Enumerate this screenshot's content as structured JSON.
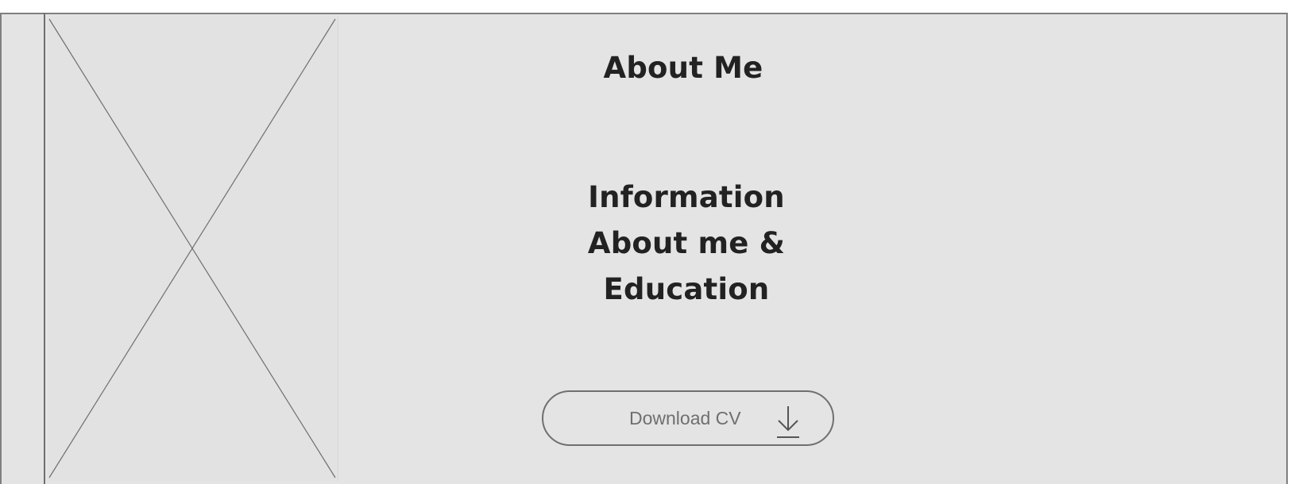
{
  "about": {
    "title": "About Me",
    "info_lines": [
      "Information",
      "About me &",
      "Education"
    ]
  },
  "image": {
    "placeholder_icon": "image-placeholder-x"
  },
  "actions": {
    "download_label": "Download CV",
    "download_icon": "arrow-down-to-line-icon"
  },
  "colors": {
    "background": "#e4e4e4",
    "text": "#222222",
    "stroke": "#6f6f6f"
  }
}
